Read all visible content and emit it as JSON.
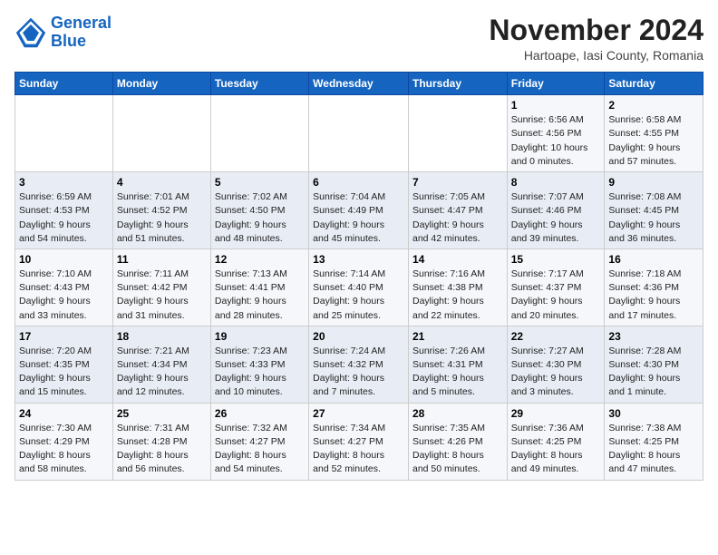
{
  "logo": {
    "line1": "General",
    "line2": "Blue"
  },
  "title": "November 2024",
  "location": "Hartoape, Iasi County, Romania",
  "weekdays": [
    "Sunday",
    "Monday",
    "Tuesday",
    "Wednesday",
    "Thursday",
    "Friday",
    "Saturday"
  ],
  "weeks": [
    [
      {
        "day": "",
        "info": ""
      },
      {
        "day": "",
        "info": ""
      },
      {
        "day": "",
        "info": ""
      },
      {
        "day": "",
        "info": ""
      },
      {
        "day": "",
        "info": ""
      },
      {
        "day": "1",
        "info": "Sunrise: 6:56 AM\nSunset: 4:56 PM\nDaylight: 10 hours\nand 0 minutes."
      },
      {
        "day": "2",
        "info": "Sunrise: 6:58 AM\nSunset: 4:55 PM\nDaylight: 9 hours\nand 57 minutes."
      }
    ],
    [
      {
        "day": "3",
        "info": "Sunrise: 6:59 AM\nSunset: 4:53 PM\nDaylight: 9 hours\nand 54 minutes."
      },
      {
        "day": "4",
        "info": "Sunrise: 7:01 AM\nSunset: 4:52 PM\nDaylight: 9 hours\nand 51 minutes."
      },
      {
        "day": "5",
        "info": "Sunrise: 7:02 AM\nSunset: 4:50 PM\nDaylight: 9 hours\nand 48 minutes."
      },
      {
        "day": "6",
        "info": "Sunrise: 7:04 AM\nSunset: 4:49 PM\nDaylight: 9 hours\nand 45 minutes."
      },
      {
        "day": "7",
        "info": "Sunrise: 7:05 AM\nSunset: 4:47 PM\nDaylight: 9 hours\nand 42 minutes."
      },
      {
        "day": "8",
        "info": "Sunrise: 7:07 AM\nSunset: 4:46 PM\nDaylight: 9 hours\nand 39 minutes."
      },
      {
        "day": "9",
        "info": "Sunrise: 7:08 AM\nSunset: 4:45 PM\nDaylight: 9 hours\nand 36 minutes."
      }
    ],
    [
      {
        "day": "10",
        "info": "Sunrise: 7:10 AM\nSunset: 4:43 PM\nDaylight: 9 hours\nand 33 minutes."
      },
      {
        "day": "11",
        "info": "Sunrise: 7:11 AM\nSunset: 4:42 PM\nDaylight: 9 hours\nand 31 minutes."
      },
      {
        "day": "12",
        "info": "Sunrise: 7:13 AM\nSunset: 4:41 PM\nDaylight: 9 hours\nand 28 minutes."
      },
      {
        "day": "13",
        "info": "Sunrise: 7:14 AM\nSunset: 4:40 PM\nDaylight: 9 hours\nand 25 minutes."
      },
      {
        "day": "14",
        "info": "Sunrise: 7:16 AM\nSunset: 4:38 PM\nDaylight: 9 hours\nand 22 minutes."
      },
      {
        "day": "15",
        "info": "Sunrise: 7:17 AM\nSunset: 4:37 PM\nDaylight: 9 hours\nand 20 minutes."
      },
      {
        "day": "16",
        "info": "Sunrise: 7:18 AM\nSunset: 4:36 PM\nDaylight: 9 hours\nand 17 minutes."
      }
    ],
    [
      {
        "day": "17",
        "info": "Sunrise: 7:20 AM\nSunset: 4:35 PM\nDaylight: 9 hours\nand 15 minutes."
      },
      {
        "day": "18",
        "info": "Sunrise: 7:21 AM\nSunset: 4:34 PM\nDaylight: 9 hours\nand 12 minutes."
      },
      {
        "day": "19",
        "info": "Sunrise: 7:23 AM\nSunset: 4:33 PM\nDaylight: 9 hours\nand 10 minutes."
      },
      {
        "day": "20",
        "info": "Sunrise: 7:24 AM\nSunset: 4:32 PM\nDaylight: 9 hours\nand 7 minutes."
      },
      {
        "day": "21",
        "info": "Sunrise: 7:26 AM\nSunset: 4:31 PM\nDaylight: 9 hours\nand 5 minutes."
      },
      {
        "day": "22",
        "info": "Sunrise: 7:27 AM\nSunset: 4:30 PM\nDaylight: 9 hours\nand 3 minutes."
      },
      {
        "day": "23",
        "info": "Sunrise: 7:28 AM\nSunset: 4:30 PM\nDaylight: 9 hours\nand 1 minute."
      }
    ],
    [
      {
        "day": "24",
        "info": "Sunrise: 7:30 AM\nSunset: 4:29 PM\nDaylight: 8 hours\nand 58 minutes."
      },
      {
        "day": "25",
        "info": "Sunrise: 7:31 AM\nSunset: 4:28 PM\nDaylight: 8 hours\nand 56 minutes."
      },
      {
        "day": "26",
        "info": "Sunrise: 7:32 AM\nSunset: 4:27 PM\nDaylight: 8 hours\nand 54 minutes."
      },
      {
        "day": "27",
        "info": "Sunrise: 7:34 AM\nSunset: 4:27 PM\nDaylight: 8 hours\nand 52 minutes."
      },
      {
        "day": "28",
        "info": "Sunrise: 7:35 AM\nSunset: 4:26 PM\nDaylight: 8 hours\nand 50 minutes."
      },
      {
        "day": "29",
        "info": "Sunrise: 7:36 AM\nSunset: 4:25 PM\nDaylight: 8 hours\nand 49 minutes."
      },
      {
        "day": "30",
        "info": "Sunrise: 7:38 AM\nSunset: 4:25 PM\nDaylight: 8 hours\nand 47 minutes."
      }
    ]
  ]
}
